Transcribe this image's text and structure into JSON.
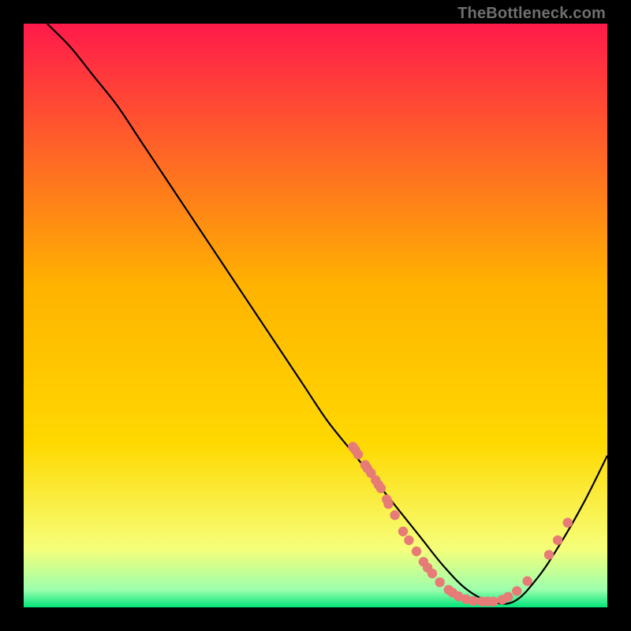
{
  "watermark": "TheBottleneck.com",
  "chart_data": {
    "type": "line",
    "title": "",
    "xlabel": "",
    "ylabel": "",
    "xlim": [
      0,
      100
    ],
    "ylim": [
      0,
      100
    ],
    "grid": false,
    "legend": false,
    "series": [
      {
        "name": "curve",
        "x": [
          4,
          8,
          12,
          16,
          20,
          24,
          28,
          32,
          36,
          40,
          44,
          48,
          52,
          56,
          60,
          64,
          68,
          72,
          76,
          80,
          84,
          88,
          92,
          96,
          100
        ],
        "y": [
          100,
          96,
          91,
          86,
          80,
          74,
          68,
          62,
          56,
          50,
          44,
          38,
          32,
          27,
          22,
          17,
          12,
          7,
          3,
          1,
          1,
          5,
          11,
          18,
          26
        ]
      }
    ],
    "points": [
      {
        "x": 56.4,
        "y": 27.5
      },
      {
        "x": 56.8,
        "y": 27.0
      },
      {
        "x": 57.3,
        "y": 26.2
      },
      {
        "x": 58.5,
        "y": 24.4
      },
      {
        "x": 58.9,
        "y": 23.8
      },
      {
        "x": 59.5,
        "y": 23.0
      },
      {
        "x": 60.3,
        "y": 21.8
      },
      {
        "x": 60.8,
        "y": 21.0
      },
      {
        "x": 61.2,
        "y": 20.4
      },
      {
        "x": 62.2,
        "y": 18.5
      },
      {
        "x": 62.5,
        "y": 17.7
      },
      {
        "x": 63.6,
        "y": 15.8
      },
      {
        "x": 65.0,
        "y": 13.0
      },
      {
        "x": 66.0,
        "y": 11.5
      },
      {
        "x": 67.3,
        "y": 9.6
      },
      {
        "x": 68.5,
        "y": 7.8
      },
      {
        "x": 69.2,
        "y": 6.8
      },
      {
        "x": 70.0,
        "y": 5.8
      },
      {
        "x": 71.3,
        "y": 4.3
      },
      {
        "x": 72.8,
        "y": 3.0
      },
      {
        "x": 73.5,
        "y": 2.5
      },
      {
        "x": 74.5,
        "y": 1.9
      },
      {
        "x": 75.8,
        "y": 1.4
      },
      {
        "x": 77.0,
        "y": 1.1
      },
      {
        "x": 78.5,
        "y": 1.0
      },
      {
        "x": 79.5,
        "y": 1.0
      },
      {
        "x": 80.5,
        "y": 1.0
      },
      {
        "x": 82.0,
        "y": 1.3
      },
      {
        "x": 83.0,
        "y": 1.8
      },
      {
        "x": 84.5,
        "y": 2.8
      },
      {
        "x": 86.3,
        "y": 4.5
      },
      {
        "x": 90.0,
        "y": 9.0
      },
      {
        "x": 91.5,
        "y": 11.5
      },
      {
        "x": 93.2,
        "y": 14.5
      }
    ],
    "colors": {
      "gradient_top": "#ff1a4b",
      "gradient_mid": "#ffd900",
      "gradient_low": "#f6ff7a",
      "gradient_bottom": "#00e57a",
      "curve": "#000000",
      "points": "#e77b76"
    }
  }
}
